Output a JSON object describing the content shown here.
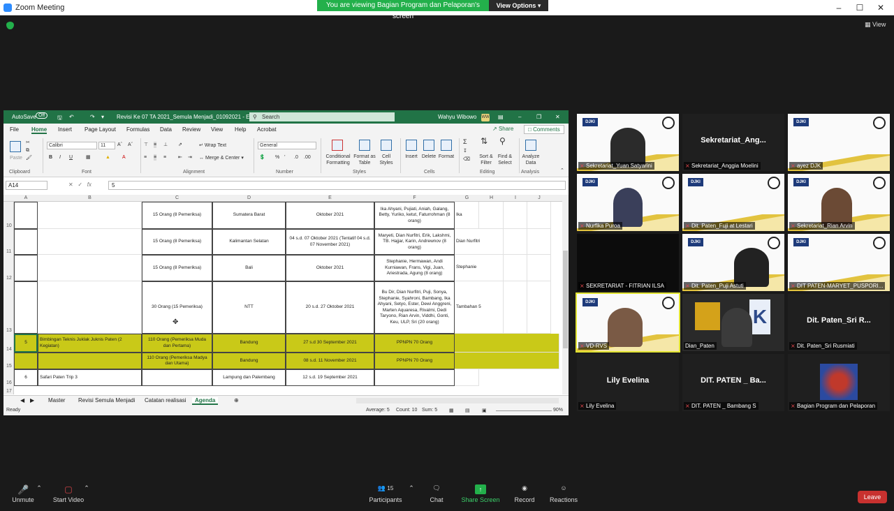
{
  "window": {
    "title": "Zoom Meeting",
    "banner": "You are viewing Bagian Program dan Pelaporan's screen",
    "view_options": "View Options",
    "view_label": "View"
  },
  "excel": {
    "autosave": "AutoSave",
    "autosave_state": "Off",
    "doc_title": "Revisi Ke 07 TA 2021_Semula Menjadi_01092021 - Excel",
    "search_placeholder": "Search",
    "user": "Wahyu Wibowo",
    "user_initials": "WW",
    "menu": [
      "File",
      "Home",
      "Insert",
      "Page Layout",
      "Formulas",
      "Data",
      "Review",
      "View",
      "Help",
      "Acrobat"
    ],
    "share": "Share",
    "comments": "Comments",
    "ribbon": {
      "paste": "Paste",
      "clipboard": "Clipboard",
      "font_name": "Calibri",
      "font_size": "11",
      "font": "Font",
      "wrap_text": "Wrap Text",
      "merge_center": "Merge & Center",
      "alignment": "Alignment",
      "number_format": "General",
      "number": "Number",
      "conditional": "Conditional Formatting",
      "format_table": "Format as Table",
      "cell_styles": "Cell Styles",
      "styles": "Styles",
      "insert": "Insert",
      "delete": "Delete",
      "format": "Format",
      "cells": "Cells",
      "sort_filter": "Sort & Filter",
      "find_select": "Find & Select",
      "editing": "Editing",
      "analyze": "Analyze Data",
      "analysis": "Analysis"
    },
    "name_box": "A14",
    "formula_value": "5",
    "columns": [
      "A",
      "B",
      "C",
      "D",
      "E",
      "F",
      "G",
      "H",
      "I",
      "J"
    ],
    "rows": [
      {
        "num": "10",
        "a": "",
        "b": "",
        "c": "15 Orang (8 Pemeriksa)",
        "d": "Sumatera Barat",
        "e": "Oktober 2021",
        "f": "Ika Ahyani, Pujiati, Aniah, Galang, Betty, Yuriko, ketut, Faturrohman (8 orang)",
        "g": "Ika"
      },
      {
        "num": "11",
        "a": "",
        "b": "",
        "c": "15 Orang (8 Pemeriksa)",
        "d": "Kalimantan Selatan",
        "e": "04 s.d. 07 Oktober 2021 (Tentatif 04 s.d. 07 November 2021)",
        "f": "Maryeti, Dian Nurfitri, Erik, Lakshmi, TB. Hajjar, Karin, Andrewnov (8 orang)",
        "g": "Dian Nurfitri"
      },
      {
        "num": "12",
        "a": "",
        "b": "",
        "c": "15 Orang (8 Pemeriksa)",
        "d": "Bali",
        "e": "Oktober 2021",
        "f": "Stephanie, Hermawan, Andi Kurniawan, Frans, Vigi, Juan, Ariestrada, Agung (8 orang)",
        "g": "Stephanie"
      },
      {
        "num": "13",
        "a": "",
        "b": "",
        "c": "30 Orang (15 Pemeriksa)",
        "d": "NTT",
        "e": "20 s.d. 27 Oktober 2021",
        "f": "Bu Dir, Dian Nurfitri, Puji, Sonya, Stephanie, Syahroni, Bambang, Ika Ahyani, Setyo, Ester, Dewi Anggreni, Marten Aquaresa, Rivalmi, Dedi Taryono, Rian Arvin, Viddhi, Gonti, Keu, ULP, Sri (20 orang)",
        "g": "Tambahan 5"
      },
      {
        "num": "14",
        "a": "5",
        "b": "Bimbingan Teknis Juklak Juknis Paten (2 Kegiatan)",
        "c": "110 Orang (Pemeriksa Muda dan Pertama)",
        "d": "Bandung",
        "e": "27 s.d 30 September 2021",
        "f": "PPNPN 70 Orang",
        "g": ""
      },
      {
        "num": "15",
        "a": "",
        "b": "",
        "c": "110 Orang (Pemeriksa Madya dan Utama)",
        "d": "Bandung",
        "e": "08 s.d. 11 November 2021",
        "f": "PPNPN 70 Orang",
        "g": ""
      },
      {
        "num": "16",
        "a": "6",
        "b": "Safari Paten Trip 3",
        "c": "",
        "d": "Lampung dan Palembang",
        "e": "12 s.d. 19 September 2021",
        "f": "",
        "g": ""
      },
      {
        "num": "17",
        "a": "",
        "b": "",
        "c": "",
        "d": "",
        "e": "",
        "f": "",
        "g": ""
      }
    ],
    "sheets": [
      "Master",
      "Revisi Semula Menjadi",
      "Catatan realisasi",
      "Agenda"
    ],
    "status": {
      "ready": "Ready",
      "average": "Average: 5",
      "count": "Count: 10",
      "sum": "Sum: 5",
      "zoom": "90%"
    }
  },
  "participants_gallery": [
    {
      "name": "Sekretariat_Yuan Satyarini",
      "type": "video"
    },
    {
      "name": "Sekretariat_Anggia Moelini",
      "type": "name",
      "big": "Sekretariat_Ang..."
    },
    {
      "name": "ayez DJK",
      "type": "video"
    },
    {
      "name": "Nurfika Puroa",
      "type": "video"
    },
    {
      "name": "Dit. Paten_Fuji at Lestari",
      "type": "video"
    },
    {
      "name": "Sekretariat_Rian Arvin",
      "type": "video"
    },
    {
      "name": "SEKRETARIAT - FITRIAN ILSA",
      "type": "dark"
    },
    {
      "name": "Dit. Paten_Puji Astuti",
      "type": "video"
    },
    {
      "name": "DIT PATEN-MARYET_PUSPORI...",
      "type": "video"
    },
    {
      "name": "VD-RVS",
      "type": "video"
    },
    {
      "name": "Dian_Paten",
      "type": "video"
    },
    {
      "name": "Dit. Paten_Sri Rusmiati",
      "type": "name",
      "big": "Dit. Paten_Sri R..."
    },
    {
      "name": "Lily Evelina",
      "type": "name",
      "big": "Lily Evelina"
    },
    {
      "name": "DIT. PATEN _ Bambang S",
      "type": "name",
      "big": "DIT. PATEN _ Ba..."
    },
    {
      "name": "Bagian Program dan Pelaporan",
      "type": "logo"
    }
  ],
  "toolbar": {
    "unmute": "Unmute",
    "start_video": "Start Video",
    "participants": "Participants",
    "participants_count": "15",
    "chat": "Chat",
    "share_screen": "Share Screen",
    "record": "Record",
    "reactions": "Reactions",
    "leave": "Leave"
  }
}
